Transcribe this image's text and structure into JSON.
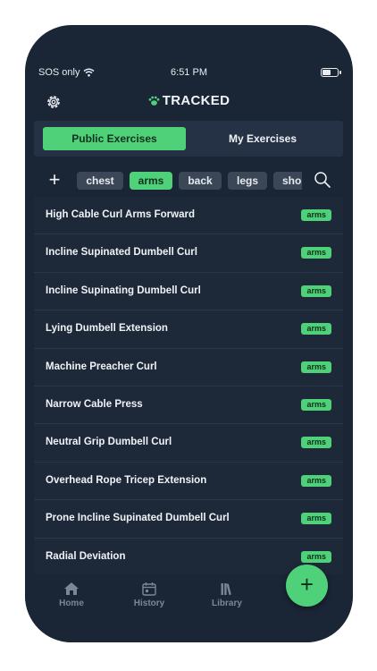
{
  "status_bar": {
    "carrier": "SOS only",
    "time": "6:51 PM"
  },
  "header": {
    "title": "TRACKED",
    "settings_icon": "gear-icon",
    "logo_icon": "paw-icon"
  },
  "segmented": {
    "tabs": [
      {
        "label": "Public Exercises",
        "active": true
      },
      {
        "label": "My Exercises",
        "active": false
      }
    ]
  },
  "filters": {
    "add_label": "+",
    "chips": [
      {
        "label": "chest",
        "selected": false
      },
      {
        "label": "arms",
        "selected": true
      },
      {
        "label": "back",
        "selected": false
      },
      {
        "label": "legs",
        "selected": false
      },
      {
        "label": "sho",
        "selected": false
      }
    ],
    "search_icon": "search-icon"
  },
  "exercises": [
    {
      "name": "High Cable Curl Arms Forward",
      "tag": "arms"
    },
    {
      "name": "Incline Supinated Dumbell Curl",
      "tag": "arms"
    },
    {
      "name": "Incline Supinating Dumbell Curl",
      "tag": "arms"
    },
    {
      "name": "Lying Dumbell Extension",
      "tag": "arms"
    },
    {
      "name": "Machine Preacher Curl",
      "tag": "arms"
    },
    {
      "name": "Narrow Cable Press",
      "tag": "arms"
    },
    {
      "name": "Neutral Grip Dumbell Curl",
      "tag": "arms"
    },
    {
      "name": "Overhead Rope Tricep Extension",
      "tag": "arms"
    },
    {
      "name": "Prone Incline Supinated Dumbell Curl",
      "tag": "arms"
    },
    {
      "name": "Radial Deviation",
      "tag": "arms"
    }
  ],
  "tabbar": {
    "items": [
      {
        "label": "Home",
        "icon": "home-icon"
      },
      {
        "label": "History",
        "icon": "calendar-icon"
      },
      {
        "label": "Library",
        "icon": "library-icon"
      }
    ]
  },
  "fab": {
    "label": "+"
  },
  "colors": {
    "accent": "#4fd17a",
    "background": "#1a2535",
    "row": "#1d2939",
    "chip": "#3b4656"
  }
}
